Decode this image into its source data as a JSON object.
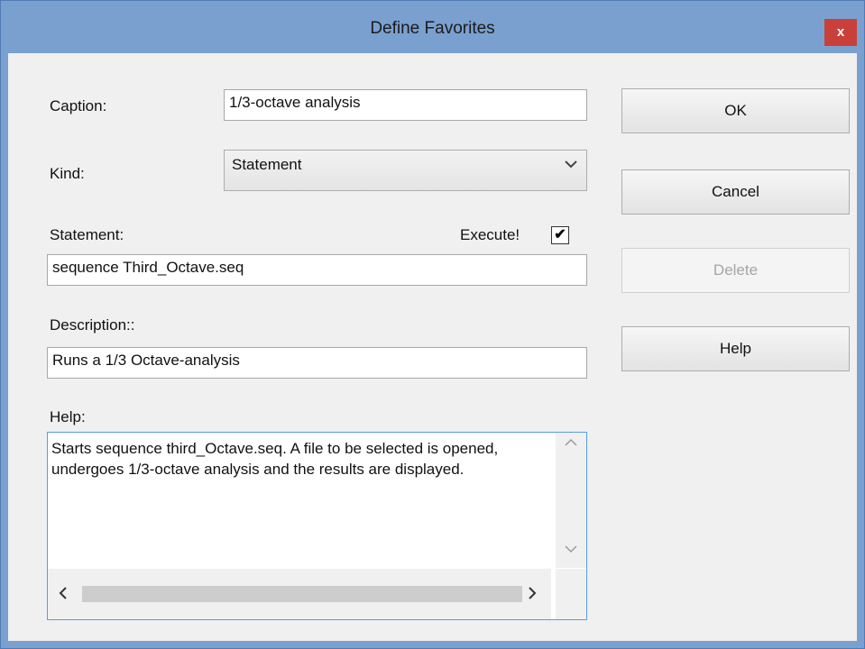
{
  "window": {
    "title": "Define Favorites",
    "close_label": "x"
  },
  "form": {
    "caption_label": "Caption:",
    "caption_value": "1/3-octave analysis",
    "kind_label": "Kind:",
    "kind_value": "Statement",
    "statement_label": "Statement:",
    "execute_label": "Execute!",
    "execute_checked": true,
    "execute_mark": "✔",
    "statement_value": "sequence Third_Octave.seq",
    "description_label": "Description::",
    "description_value": "Runs a 1/3 Octave-analysis",
    "help_label": "Help:",
    "help_value": "Starts sequence third_Octave.seq. A file to be selected is opened, undergoes 1/3-octave analysis and the results are displayed."
  },
  "buttons": {
    "ok": "OK",
    "cancel": "Cancel",
    "delete": "Delete",
    "help": "Help"
  },
  "icons": {
    "close": "close-icon",
    "dropdown": "chevron-down-icon",
    "scroll_up": "chevron-up-icon",
    "scroll_down": "chevron-down-icon",
    "scroll_left": "chevron-left-icon",
    "scroll_right": "chevron-right-icon"
  },
  "colors": {
    "titlebar": "#7aa0cf",
    "close_button": "#c9403a",
    "focus_border": "#569de5"
  }
}
